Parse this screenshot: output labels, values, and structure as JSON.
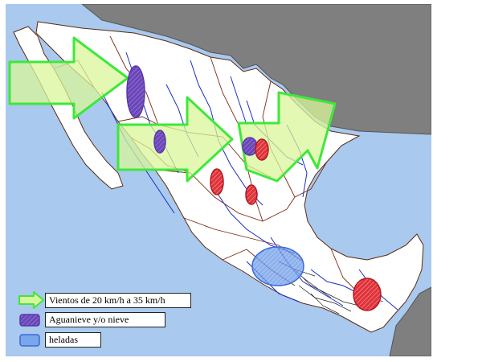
{
  "map": {
    "colors": {
      "ocean": "#a9c9ee",
      "land": "#ffffff",
      "neighbor": "#7f7f7f",
      "rivers": "#1a2fc6",
      "roads": "#7a2a10",
      "wind_arrow_fill": "#d9f59a",
      "wind_arrow_stroke": "#3ee83a",
      "sleet_snow": "#6a46b8",
      "frost": "#7aa6ec",
      "hot_spot": "#e0323a"
    }
  },
  "legend": {
    "items": [
      {
        "id": "wind",
        "label": "Vientos de 20 km/h a 35 km/h",
        "icon": "green-arrow-icon"
      },
      {
        "id": "sleet",
        "label": "Aguanieve y/o nieve",
        "icon": "purple-hatch-swatch-icon"
      },
      {
        "id": "frost",
        "label": "heladas",
        "icon": "blue-swatch-icon"
      }
    ]
  }
}
